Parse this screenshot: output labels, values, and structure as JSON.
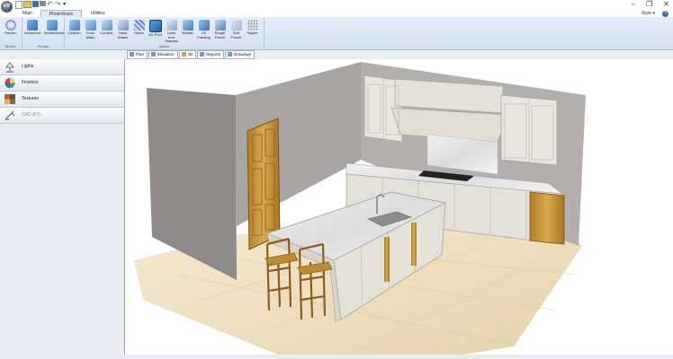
{
  "app": {
    "logo_text": "cV"
  },
  "menu_tabs": [
    {
      "label": "Main"
    },
    {
      "label": "PhotoVision"
    },
    {
      "label": "Utilities"
    }
  ],
  "style_menu": "Style",
  "ribbon": {
    "groups": [
      {
        "label": "Modes",
        "buttons": [
          {
            "label": "Render",
            "icon": "render-icon"
          }
        ]
      },
      {
        "label": "Render",
        "buttons": [
          {
            "label": "Advanced",
            "icon": "advanced-icon"
          },
          {
            "label": "Architectural",
            "icon": "architectural-icon"
          }
        ]
      },
      {
        "label": "Sketch",
        "buttons": [
          {
            "label": "Cartoon",
            "icon": "cartoon-icon"
          },
          {
            "label": "Color Wash",
            "icon": "color-wash-icon"
          },
          {
            "label": "Contour",
            "icon": "contour-icon"
          },
          {
            "label": "Hand Drawn",
            "icon": "hand-drawn-icon"
          },
          {
            "label": "Hatch",
            "icon": "hatch-icon"
          },
          {
            "label": "Ink Print",
            "icon": "ink-print-icon"
          },
          {
            "label": "Lines and Shadow",
            "icon": "lines-shadow-icon"
          },
          {
            "label": "Mosaic",
            "icon": "mosaic-icon"
          },
          {
            "label": "Oil Painting",
            "icon": "oil-painting-icon"
          },
          {
            "label": "Rough Pencil",
            "icon": "rough-pencil-icon"
          },
          {
            "label": "Soft Pencil",
            "icon": "soft-pencil-icon"
          },
          {
            "label": "Stipple",
            "icon": "stipple-icon"
          }
        ]
      }
    ]
  },
  "doc_tabs": [
    {
      "label": "Plan"
    },
    {
      "label": "Elevation"
    },
    {
      "label": "3D"
    },
    {
      "label": "Reports"
    },
    {
      "label": "Drawings"
    }
  ],
  "sidebar": {
    "items": [
      {
        "label": "Lights",
        "icon": "lamp-icon"
      },
      {
        "label": "Finishes",
        "icon": "color-wheel-icon"
      },
      {
        "label": "Textures",
        "icon": "textures-icon"
      },
      {
        "label": "CAD (F7)",
        "icon": "cad-icon"
      }
    ]
  },
  "colors": {
    "ribbon": "#dce6f2",
    "wall": "#a7a2a0",
    "cabinet": "#e4e1d8",
    "floor": "#efe2c8",
    "wood": "#c99a3c"
  }
}
